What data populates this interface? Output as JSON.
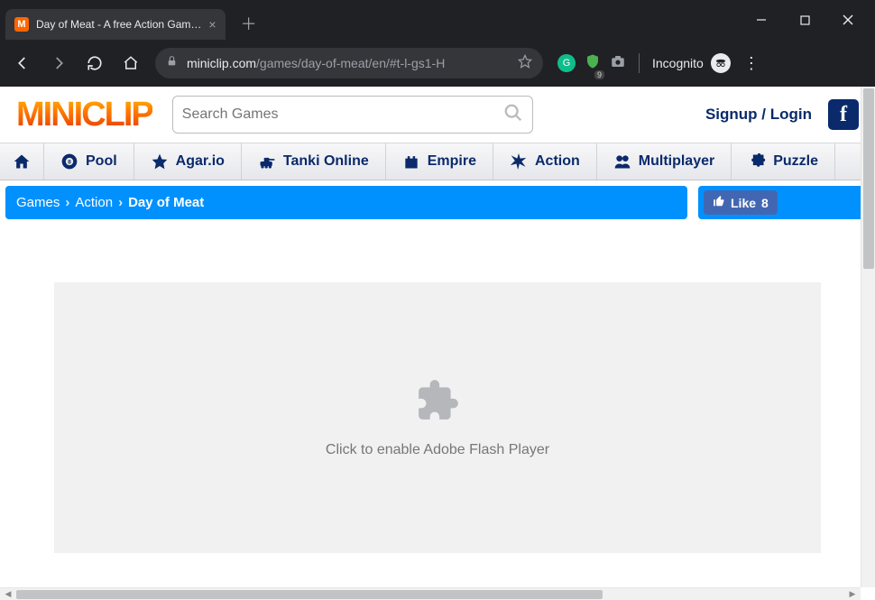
{
  "browser": {
    "tab_title": "Day of Meat - A free Action Gam…",
    "url_host": "miniclip.com",
    "url_path": "/games/day-of-meat/en/#t-l-gs1-H",
    "incognito_label": "Incognito",
    "ext_badge": "9"
  },
  "header": {
    "logo_text": "MINICLIP",
    "search_placeholder": "Search Games",
    "signup_label": "Signup / Login"
  },
  "nav": {
    "items": [
      {
        "label": ""
      },
      {
        "label": "Pool"
      },
      {
        "label": "Agar.io"
      },
      {
        "label": "Tanki Online"
      },
      {
        "label": "Empire"
      },
      {
        "label": "Action"
      },
      {
        "label": "Multiplayer"
      },
      {
        "label": "Puzzle"
      }
    ]
  },
  "breadcrumb": {
    "root": "Games",
    "category": "Action",
    "current": "Day of Meat",
    "sep": "›"
  },
  "like": {
    "label": "Like",
    "count": "8"
  },
  "game": {
    "flash_text": "Click to enable Adobe Flash Player"
  }
}
